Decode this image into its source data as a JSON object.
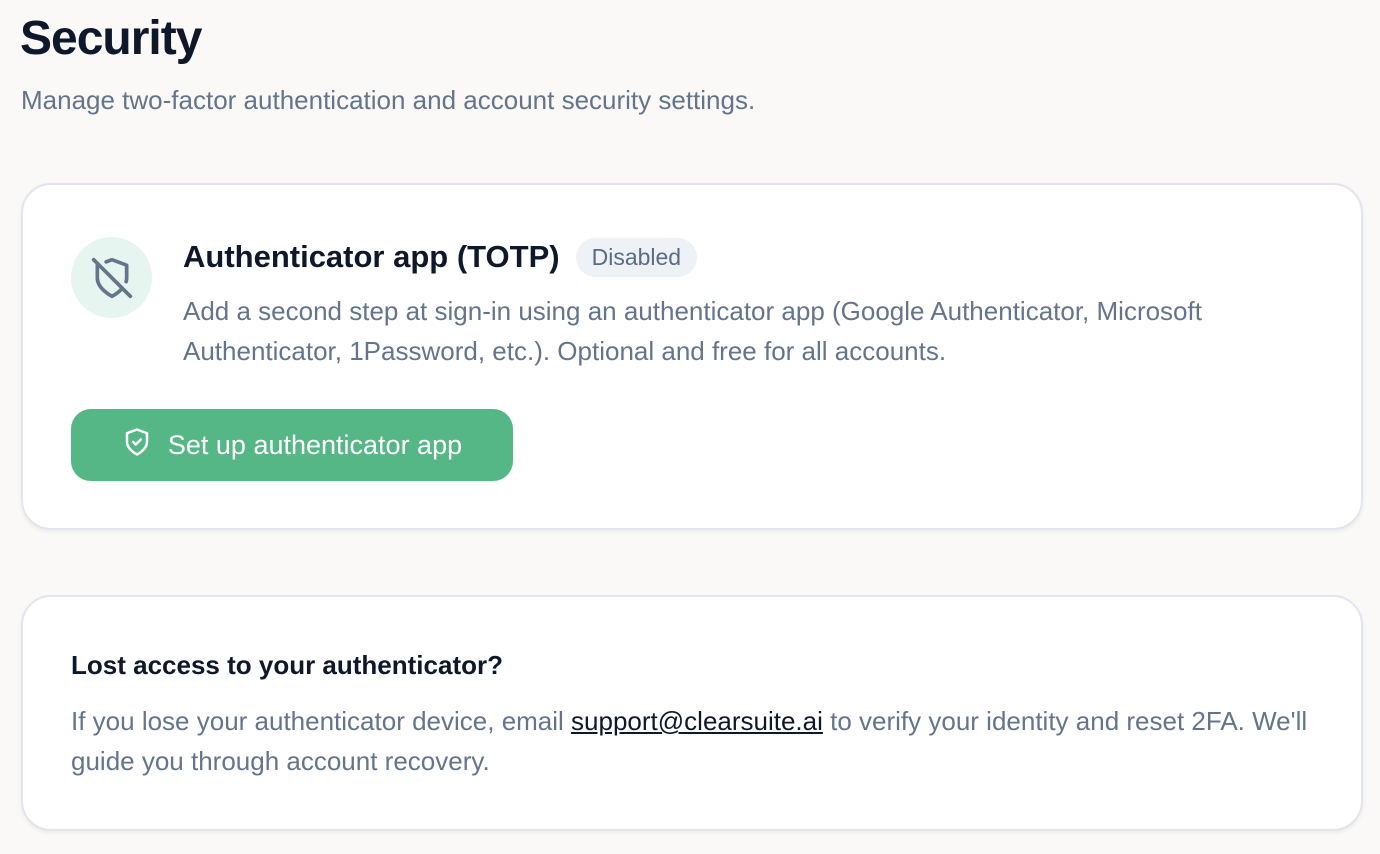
{
  "header": {
    "title": "Security",
    "subtitle": "Manage two-factor authentication and account security settings."
  },
  "totp_card": {
    "icon": "shield-off-icon",
    "title": "Authenticator app (TOTP)",
    "status": "Disabled",
    "description": "Add a second step at sign-in using an authenticator app (Google Authenticator, Microsoft Authenticator, 1Password, etc.). Optional and free for all accounts.",
    "button_icon": "shield-check-icon",
    "button_label": "Set up authenticator app"
  },
  "recovery_card": {
    "title": "Lost access to your authenticator?",
    "text_before": "If you lose your authenticator device, email ",
    "link_text": "support@clearsuite.ai",
    "text_after": " to verify your identity and reset 2FA. We'll guide you through account recovery."
  },
  "colors": {
    "accent": "#55b686",
    "badge_bg": "#eef1f6",
    "icon_circle_bg": "#e6f5f0",
    "text_primary": "#0f172a",
    "text_muted": "#64748b"
  }
}
